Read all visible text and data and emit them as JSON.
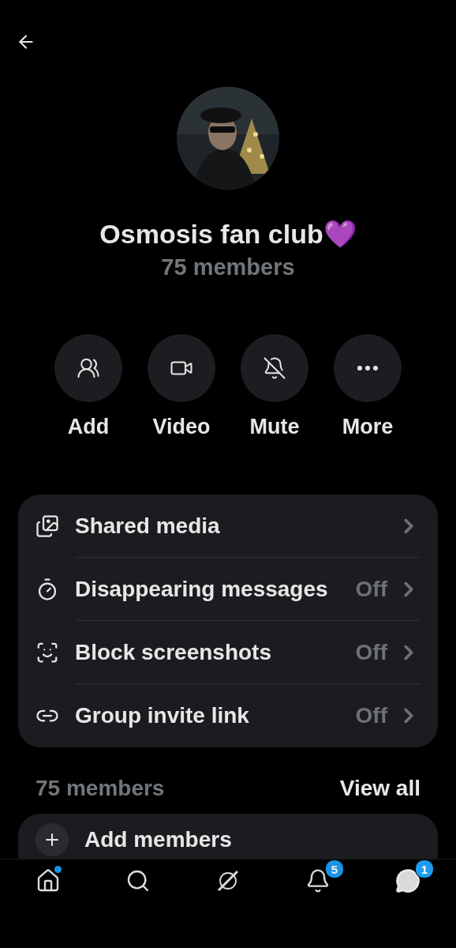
{
  "group": {
    "name": "Osmosis fan club💜",
    "members": "75 members"
  },
  "actions": [
    {
      "kind": "add",
      "label": "Add"
    },
    {
      "kind": "video",
      "label": "Video"
    },
    {
      "kind": "mute",
      "label": "Mute"
    },
    {
      "kind": "more",
      "label": "More"
    }
  ],
  "settings": [
    {
      "kind": "media",
      "label": "Shared media"
    },
    {
      "kind": "timer",
      "label": "Disappearing messages",
      "value": "Off"
    },
    {
      "kind": "screenshot",
      "label": "Block screenshots",
      "value": "Off"
    },
    {
      "kind": "link",
      "label": "Group invite link",
      "value": "Off"
    }
  ],
  "members_section": {
    "title": "75 members",
    "link": "View all",
    "add_label": "Add members"
  },
  "nav": [
    {
      "kind": "home",
      "selected": false,
      "dot": true
    },
    {
      "kind": "search",
      "selected": false
    },
    {
      "kind": "slashed",
      "selected": false
    },
    {
      "kind": "bell",
      "selected": false,
      "badge": "5"
    },
    {
      "kind": "messages",
      "selected": true,
      "badge": "1"
    }
  ]
}
